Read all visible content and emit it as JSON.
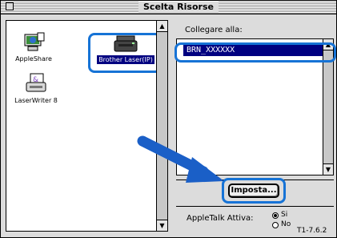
{
  "window": {
    "title": "Scelta Risorse"
  },
  "chooser": {
    "items": [
      {
        "label": "AppleShare",
        "icon": "appleshare-icon",
        "selected": false
      },
      {
        "label": "Brother Laser(IP)",
        "icon": "printer-icon",
        "selected": true
      },
      {
        "label": "LaserWriter 8",
        "icon": "laserwriter-icon",
        "selected": false
      }
    ]
  },
  "connect": {
    "label": "Collegare alla:",
    "selected_device": "BRN_XXXXXX"
  },
  "setup_button": {
    "label": "Imposta..."
  },
  "appletalk": {
    "label": "AppleTalk Attiva:",
    "options": [
      "Si",
      "No"
    ],
    "selected": "Si"
  },
  "reference_code": "T1-7.6.2",
  "colors": {
    "highlight": "#1673d6",
    "arrow": "#1a5fc7",
    "selection": "#000080"
  }
}
